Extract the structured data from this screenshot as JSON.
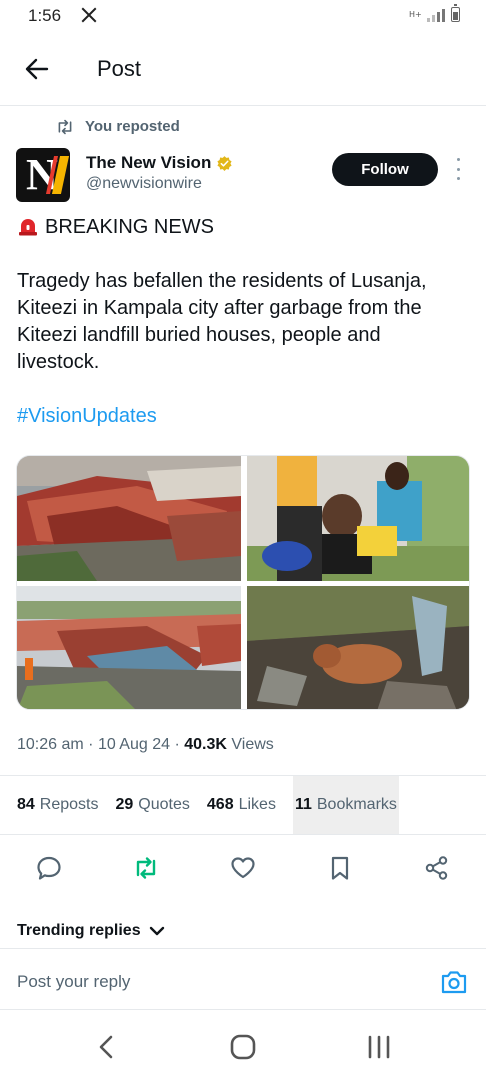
{
  "status_bar": {
    "time": "1:56",
    "network_label": "H+"
  },
  "header": {
    "title": "Post"
  },
  "repost": {
    "text": "You reposted"
  },
  "author": {
    "name": "The New Vision",
    "handle": "@newvisionwire",
    "follow_label": "Follow"
  },
  "tweet": {
    "headline": "BREAKING NEWS",
    "body": "Tragedy has befallen the residents of Lusanja, Kiteezi in Kampala city after garbage from the Kiteezi landfill buried houses, people and livestock.",
    "hashtag": "#VisionUpdates"
  },
  "meta": {
    "time": "10:26 am",
    "date": "10 Aug 24",
    "views_count": "40.3K",
    "views_label": "Views"
  },
  "stats": [
    {
      "count": "84",
      "label": "Reposts"
    },
    {
      "count": "29",
      "label": "Quotes"
    },
    {
      "count": "468",
      "label": "Likes"
    },
    {
      "count": "11",
      "label": "Bookmarks"
    }
  ],
  "trending": {
    "label": "Trending replies"
  },
  "reply": {
    "placeholder": "Post your reply"
  },
  "colors": {
    "accent": "#1d9bf0",
    "repost_green": "#00ba7c",
    "text_primary": "#0f1419",
    "text_secondary": "#536471",
    "verified_gold": "#e2b719"
  },
  "icons": [
    "x-logo-icon",
    "back-arrow-icon",
    "repost-icon",
    "verified-badge-icon",
    "siren-icon",
    "reply-icon",
    "like-icon",
    "bookmark-icon",
    "share-icon",
    "chevron-down-icon",
    "camera-icon",
    "nav-back-icon",
    "nav-home-icon",
    "nav-recents-icon"
  ]
}
